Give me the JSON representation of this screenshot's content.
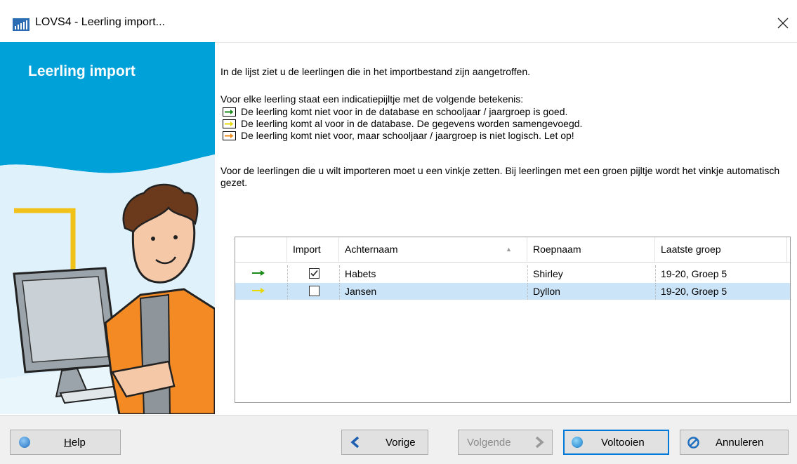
{
  "window": {
    "title": "LOVS4 - Leerling import..."
  },
  "sidebar": {
    "title": "Leerling import"
  },
  "intro": {
    "line1": "In de lijst ziet u de leerlingen die in het importbestand zijn aangetroffen.",
    "line2": "Voor elke leerling staat een indicatiepijltje met de volgende betekenis:",
    "legend": [
      {
        "text": "De leerling komt niet voor in de database en schooljaar / jaargroep is goed.",
        "color": "#1a8a1a"
      },
      {
        "text": "De leerling komt al voor in de database. De gegevens worden samengevoegd.",
        "color": "#e6d800"
      },
      {
        "text": "De leerling komt niet voor, maar schooljaar / jaargroep is niet logisch. Let op!",
        "color": "#f08c1a"
      }
    ],
    "line3": "Voor de leerlingen die u wilt importeren moet u een vinkje zetten. Bij leerlingen met een groen pijltje wordt het vinkje automatisch gezet."
  },
  "grid": {
    "columns": [
      "",
      "Import",
      "Achternaam",
      "Roepnaam",
      "Laatste groep"
    ],
    "rows": [
      {
        "arrow_color": "#1a8a1a",
        "import": true,
        "achternaam": "Habets",
        "roepnaam": "Shirley",
        "groep": "19-20, Groep 5",
        "selected": false
      },
      {
        "arrow_color": "#e6d800",
        "import": false,
        "achternaam": "Jansen",
        "roepnaam": "Dyllon",
        "groep": "19-20, Groep 5",
        "selected": true
      }
    ]
  },
  "footer": {
    "help_label": "Help",
    "help_underline": "H",
    "help_rest": "elp",
    "vorige_label": "Vorige",
    "volgende_label": "Volgende",
    "voltooien_label": "Voltooien",
    "annuleren_label": "Annuleren"
  },
  "colors": {
    "accent": "#00a0d8",
    "selection": "#cce4f7",
    "button_border": "#0078d7"
  }
}
